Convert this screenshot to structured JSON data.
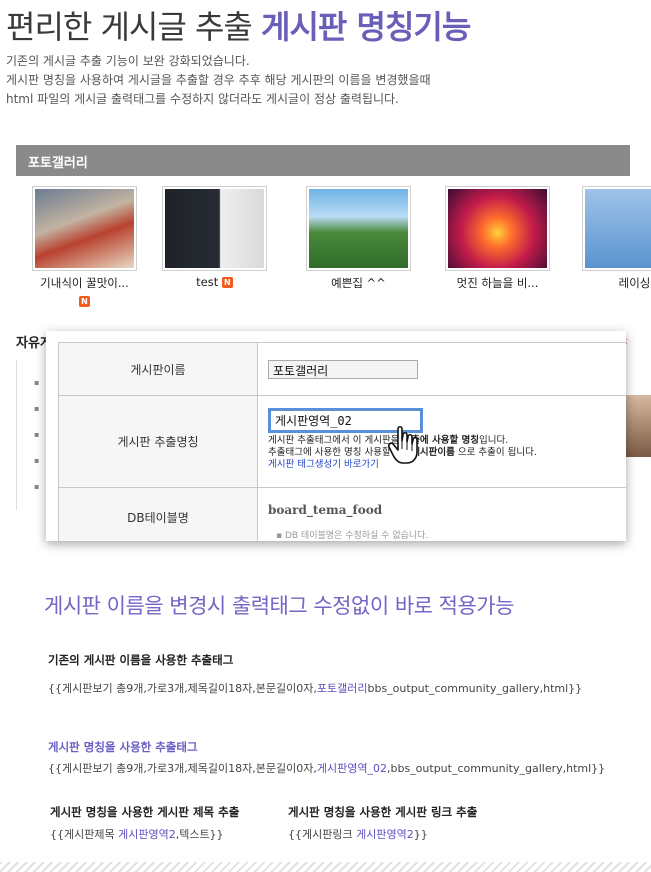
{
  "header": {
    "title_plain": "편리한 게시글 추출",
    "title_accent": "게시판 명칭기능",
    "intro": [
      "기존의 게시글 추출 기능이 보완 강화되었습니다.",
      "게시판 명칭을 사용하여 게시글을 추출할 경우 추후 해당 게시판의 이름을 변경했을때",
      "html  파일의 게시글 출력태그를 수정하지 않더라도 게시글이 정상 출력됩니다."
    ]
  },
  "gallery": {
    "title": "포토갤러리",
    "items": [
      {
        "caption": "기내식이 꿀맛이...",
        "badge": "N"
      },
      {
        "caption": "test",
        "badge": "N"
      },
      {
        "caption": "예쁜집 ^^",
        "badge": ""
      },
      {
        "caption": "멋진 하늘을 비...",
        "badge": ""
      },
      {
        "caption": "레이싱",
        "badge": ""
      }
    ],
    "next_label": "자유게시판"
  },
  "popup": {
    "rows": [
      {
        "label": "게시판이름",
        "value": "포토갤러리"
      },
      {
        "label": "게시판 추출명칭",
        "value": "게시판영역_02"
      },
      {
        "label": "DB테이블명",
        "value": "board_tema_food"
      }
    ],
    "help_line1_a": "게시판 추출태그에서 이 게시판을 ",
    "help_line1_b": "추출에 사용할 명칭",
    "help_line1_c": "입니다.",
    "help_line2_a": "추출태그에 사용한 명칭 사용할경우 ",
    "help_line2_b": "게시판이름",
    "help_line2_c": " 으로 추출이 됩니다.",
    "help_link": "게시판 태그생성기 바로가기",
    "db_note": "DB 테이블명은 수정하실 수 없습니다."
  },
  "section": {
    "title": "게시판 이름을 변경시 출력태그 수정없이 바로 적용가능",
    "block1": {
      "heading": "기존의 게시판 이름을 사용한 추출태그",
      "code_pre": "{{게시판보기 총9개,가로3개,제목길이18자,본문길이0자,",
      "code_hl": "포토갤러리",
      "code_post": "bbs_output_community_gallery,html}}"
    },
    "block2": {
      "heading": "게시판 명칭을 사용한 추출태그",
      "code_pre": "{{게시판보기 총9개,가로3개,제목길이18자,본문길이0자,",
      "code_hl": "게시판영역_02",
      "code_post": ",bbs_output_community_gallery,html}}"
    },
    "block3": {
      "heading": "게시판 명칭을 사용한 게시판 제목 추출",
      "code_pre": "{{게시판제목 ",
      "code_hl": "게시판영역2",
      "code_post": ",텍스트}}"
    },
    "block4": {
      "heading": "게시판 명칭을 사용한 게시판 링크 추출",
      "code_pre": "{{게시판링크 ",
      "code_hl": "게시판영역2",
      "code_post": "}}"
    }
  }
}
